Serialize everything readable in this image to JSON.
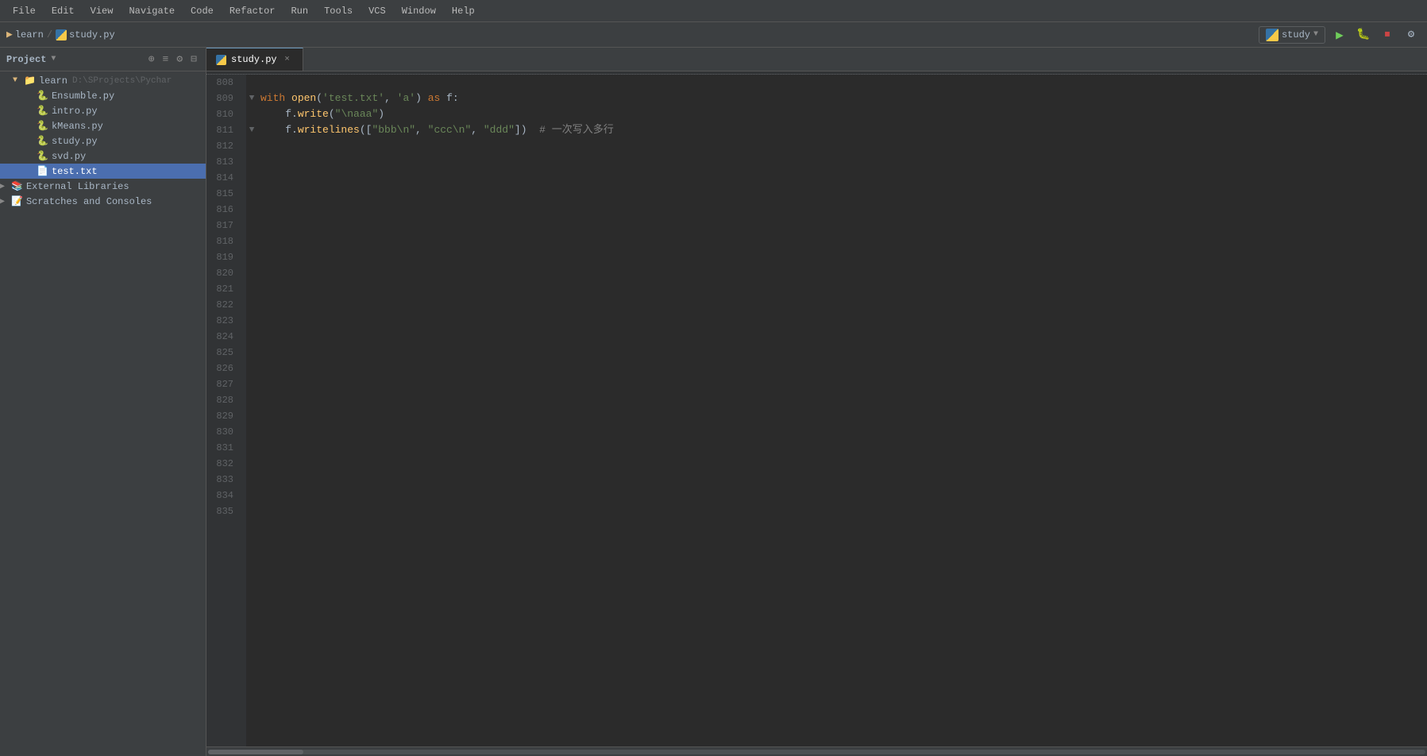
{
  "menubar": {
    "items": [
      "File",
      "Edit",
      "View",
      "Navigate",
      "Code",
      "Refactor",
      "Run",
      "Tools",
      "VCS",
      "Window",
      "Help"
    ]
  },
  "breadcrumb": {
    "project_name": "learn",
    "file_name": "study.py"
  },
  "tabs": [
    {
      "label": "study.py",
      "active": true,
      "close": "×"
    }
  ],
  "sidebar": {
    "header": "Project",
    "tree": [
      {
        "level": 0,
        "type": "folder",
        "label": "learn",
        "path": "D:\\SProjects\\Pychar",
        "expanded": true
      },
      {
        "level": 1,
        "type": "python",
        "label": "Ensumble.py"
      },
      {
        "level": 1,
        "type": "python",
        "label": "intro.py"
      },
      {
        "level": 1,
        "type": "python",
        "label": "kMeans.py"
      },
      {
        "level": 1,
        "type": "python",
        "label": "study.py"
      },
      {
        "level": 1,
        "type": "python",
        "label": "svd.py"
      },
      {
        "level": 1,
        "type": "text",
        "label": "test.txt",
        "selected": true
      },
      {
        "level": 0,
        "type": "folder",
        "label": "External Libraries",
        "expanded": false
      },
      {
        "level": 0,
        "type": "folder",
        "label": "Scratches and Consoles",
        "expanded": false
      }
    ]
  },
  "run_config": {
    "label": "study",
    "icon": "py"
  },
  "code": {
    "lines": [
      {
        "num": 808,
        "content": ""
      },
      {
        "num": 809,
        "content": "with open('test.txt', 'a') as f:",
        "has_fold": true
      },
      {
        "num": 810,
        "content": "    f.write(\"\\naaa\")"
      },
      {
        "num": 811,
        "content": "    f.writelines([\"bbb\\n\", \"ccc\\n\", \"ddd\"])  # 一次写入多行",
        "has_fold": true
      },
      {
        "num": 812,
        "content": ""
      },
      {
        "num": 813,
        "content": ""
      },
      {
        "num": 814,
        "content": ""
      },
      {
        "num": 815,
        "content": ""
      },
      {
        "num": 816,
        "content": ""
      },
      {
        "num": 817,
        "content": ""
      },
      {
        "num": 818,
        "content": ""
      },
      {
        "num": 819,
        "content": ""
      },
      {
        "num": 820,
        "content": ""
      },
      {
        "num": 821,
        "content": ""
      },
      {
        "num": 822,
        "content": ""
      },
      {
        "num": 823,
        "content": ""
      },
      {
        "num": 824,
        "content": ""
      },
      {
        "num": 825,
        "content": ""
      },
      {
        "num": 826,
        "content": ""
      },
      {
        "num": 827,
        "content": ""
      },
      {
        "num": 828,
        "content": ""
      },
      {
        "num": 829,
        "content": ""
      },
      {
        "num": 830,
        "content": ""
      },
      {
        "num": 831,
        "content": ""
      },
      {
        "num": 832,
        "content": ""
      },
      {
        "num": 833,
        "content": ""
      },
      {
        "num": 834,
        "content": ""
      },
      {
        "num": 835,
        "content": ""
      }
    ]
  }
}
